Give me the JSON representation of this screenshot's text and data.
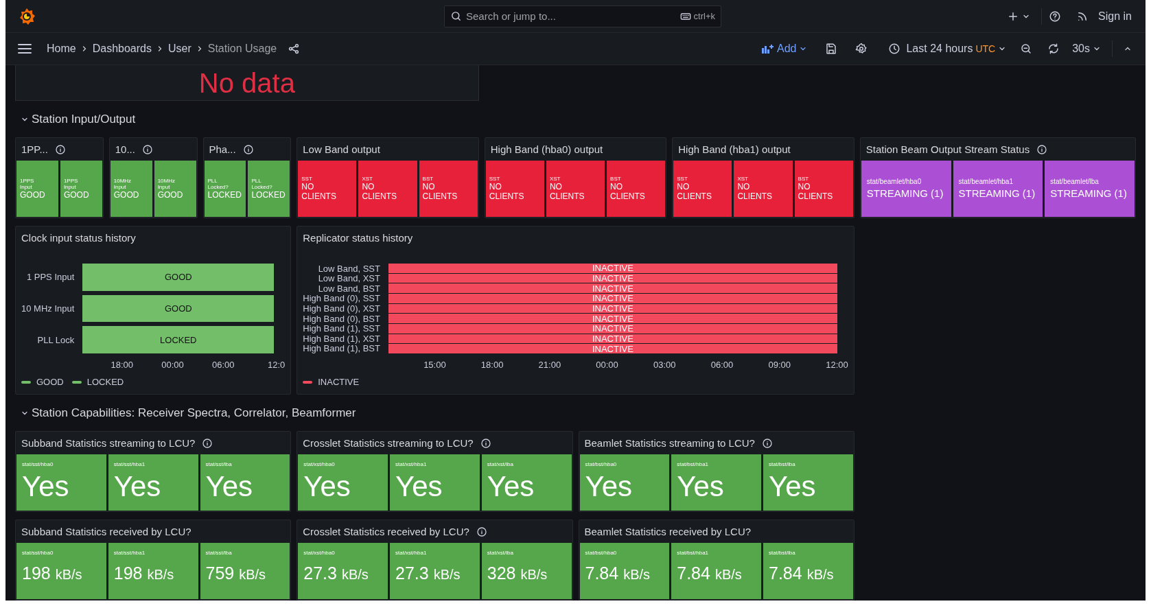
{
  "topbar": {
    "search_placeholder": "Search or jump to...",
    "shortcut": "ctrl+k",
    "sign_in": "Sign in"
  },
  "breadcrumbs": [
    {
      "label": "Home",
      "current": false
    },
    {
      "label": "Dashboards",
      "current": false
    },
    {
      "label": "User",
      "current": false
    },
    {
      "label": "Station Usage",
      "current": true
    }
  ],
  "toolbar": {
    "add": "Add",
    "time_range": "Last 24 hours",
    "timezone": "UTC",
    "refresh_interval": "30s"
  },
  "no_data_panel": {
    "message": "No data"
  },
  "sections": [
    {
      "title": "Station Input/Output",
      "expanded": true,
      "panels": [
        {
          "kind": "compact",
          "title": "1PP...",
          "info": true,
          "tiles": [
            {
              "color": "#56a64b",
              "label": "1PPS Input",
              "value": "GOOD"
            },
            {
              "color": "#56a64b",
              "label": "1PPS Input",
              "value": "GOOD"
            }
          ]
        },
        {
          "kind": "compact",
          "title": "10...",
          "info": true,
          "tiles": [
            {
              "color": "#56a64b",
              "label": "10MHz Input",
              "value": "GOOD"
            },
            {
              "color": "#56a64b",
              "label": "10MHz Input",
              "value": "GOOD"
            }
          ]
        },
        {
          "kind": "compact",
          "title": "Pha...",
          "info": true,
          "tiles": [
            {
              "color": "#56a64b",
              "label": "PLL Locked?",
              "value": "LOCKED"
            },
            {
              "color": "#56a64b",
              "label": "PLL Locked?",
              "value": "LOCKED"
            }
          ]
        },
        {
          "kind": "compact",
          "title": "Low Band output",
          "info": false,
          "tiles": [
            {
              "color": "#e8213a",
              "label": "SST",
              "value": "NO CLIENTS"
            },
            {
              "color": "#e8213a",
              "label": "XST",
              "value": "NO CLIENTS"
            },
            {
              "color": "#e8213a",
              "label": "BST",
              "value": "NO CLIENTS"
            }
          ]
        },
        {
          "kind": "compact",
          "title": "High Band (hba0) output",
          "info": false,
          "tiles": [
            {
              "color": "#e8213a",
              "label": "SST",
              "value": "NO CLIENTS"
            },
            {
              "color": "#e8213a",
              "label": "XST",
              "value": "NO CLIENTS"
            },
            {
              "color": "#e8213a",
              "label": "BST",
              "value": "NO CLIENTS"
            }
          ]
        },
        {
          "kind": "compact",
          "title": "High Band (hba1) output",
          "info": false,
          "tiles": [
            {
              "color": "#e8213a",
              "label": "SST",
              "value": "NO CLIENTS"
            },
            {
              "color": "#e8213a",
              "label": "XST",
              "value": "NO CLIENTS"
            },
            {
              "color": "#e8213a",
              "label": "BST",
              "value": "NO CLIENTS"
            }
          ]
        },
        {
          "kind": "stream",
          "title": "Station Beam Output Stream Status",
          "info": true,
          "tiles": [
            {
              "color": "#ab4fd5",
              "label": "stat/beamlet/hba0",
              "value": "STREAMING (1)"
            },
            {
              "color": "#ab4fd5",
              "label": "stat/beamlet/hba1",
              "value": "STREAMING (1)"
            },
            {
              "color": "#ab4fd5",
              "label": "stat/beamlet/lba",
              "value": "STREAMING (1)"
            }
          ]
        },
        {
          "kind": "timeline",
          "title": "Clock input status history",
          "info": false,
          "rows": [
            {
              "label": "1 PPS Input",
              "value": "GOOD",
              "color": "#73bf69"
            },
            {
              "label": "10 MHz Input",
              "value": "GOOD",
              "color": "#73bf69"
            },
            {
              "label": "PLL Lock",
              "value": "LOCKED",
              "color": "#73bf69"
            }
          ],
          "xticks": [
            "18:00",
            "00:00",
            "06:00",
            "12:0"
          ],
          "legend": [
            {
              "label": "GOOD",
              "color": "#73bf69"
            },
            {
              "label": "LOCKED",
              "color": "#73bf69"
            }
          ]
        },
        {
          "kind": "timeline",
          "title": "Replicator status history",
          "info": false,
          "rows": [
            {
              "label": "Low Band, SST",
              "value": "INACTIVE",
              "color": "#f2495c"
            },
            {
              "label": "Low Band, XST",
              "value": "INACTIVE",
              "color": "#f2495c"
            },
            {
              "label": "Low Band, BST",
              "value": "INACTIVE",
              "color": "#f2495c"
            },
            {
              "label": "High Band (0), SST",
              "value": "INACTIVE",
              "color": "#f2495c"
            },
            {
              "label": "High Band (0), XST",
              "value": "INACTIVE",
              "color": "#f2495c"
            },
            {
              "label": "High Band (0), BST",
              "value": "INACTIVE",
              "color": "#f2495c"
            },
            {
              "label": "High Band (1), SST",
              "value": "INACTIVE",
              "color": "#f2495c"
            },
            {
              "label": "High Band (1), XST",
              "value": "INACTIVE",
              "color": "#f2495c"
            },
            {
              "label": "High Band (1), BST",
              "value": "INACTIVE",
              "color": "#f2495c"
            }
          ],
          "xticks": [
            "15:00",
            "18:00",
            "21:00",
            "00:00",
            "03:00",
            "06:00",
            "09:00",
            "12:00"
          ],
          "legend": [
            {
              "label": "INACTIVE",
              "color": "#f2495c"
            }
          ]
        }
      ]
    },
    {
      "title": "Station Capabilities: Receiver Spectra, Correlator, Beamformer",
      "expanded": true,
      "panels": [
        {
          "kind": "big",
          "title": "Subband Statistics streaming to LCU?",
          "info": true,
          "tiles": [
            {
              "color": "#56a64b",
              "label": "stat/sst/hba0",
              "value": "Yes"
            },
            {
              "color": "#56a64b",
              "label": "stat/sst/hba1",
              "value": "Yes"
            },
            {
              "color": "#56a64b",
              "label": "stat/sst/lba",
              "value": "Yes"
            }
          ]
        },
        {
          "kind": "big",
          "title": "Crosslet Statistics streaming to LCU?",
          "info": true,
          "tiles": [
            {
              "color": "#56a64b",
              "label": "stat/xst/hba0",
              "value": "Yes"
            },
            {
              "color": "#56a64b",
              "label": "stat/xst/hba1",
              "value": "Yes"
            },
            {
              "color": "#56a64b",
              "label": "stat/xst/lba",
              "value": "Yes"
            }
          ]
        },
        {
          "kind": "big",
          "title": "Beamlet Statistics streaming to LCU?",
          "info": true,
          "tiles": [
            {
              "color": "#56a64b",
              "label": "stat/bst/hba0",
              "value": "Yes"
            },
            {
              "color": "#56a64b",
              "label": "stat/bst/hba1",
              "value": "Yes"
            },
            {
              "color": "#56a64b",
              "label": "stat/bst/lba",
              "value": "Yes"
            }
          ]
        },
        {
          "kind": "rate",
          "title": "Subband Statistics received by LCU?",
          "info": false,
          "tiles": [
            {
              "color": "#56a64b",
              "label": "stat/sst/hba0",
              "value": "198",
              "unit": "kB/s"
            },
            {
              "color": "#56a64b",
              "label": "stat/sst/hba1",
              "value": "198",
              "unit": "kB/s"
            },
            {
              "color": "#56a64b",
              "label": "stat/sst/lba",
              "value": "759",
              "unit": "kB/s"
            }
          ]
        },
        {
          "kind": "rate",
          "title": "Crosslet Statistics received by LCU?",
          "info": true,
          "tiles": [
            {
              "color": "#56a64b",
              "label": "stat/xst/hba0",
              "value": "27.3",
              "unit": "kB/s"
            },
            {
              "color": "#56a64b",
              "label": "stat/xst/hba1",
              "value": "27.3",
              "unit": "kB/s"
            },
            {
              "color": "#56a64b",
              "label": "stat/xst/lba",
              "value": "328",
              "unit": "kB/s"
            }
          ]
        },
        {
          "kind": "rate",
          "title": "Beamlet Statistics received by LCU?",
          "info": false,
          "tiles": [
            {
              "color": "#56a64b",
              "label": "stat/bst/hba0",
              "value": "7.84",
              "unit": "kB/s"
            },
            {
              "color": "#56a64b",
              "label": "stat/bst/hba1",
              "value": "7.84",
              "unit": "kB/s"
            },
            {
              "color": "#56a64b",
              "label": "stat/bst/lba",
              "value": "7.84",
              "unit": "kB/s"
            }
          ]
        }
      ]
    }
  ]
}
